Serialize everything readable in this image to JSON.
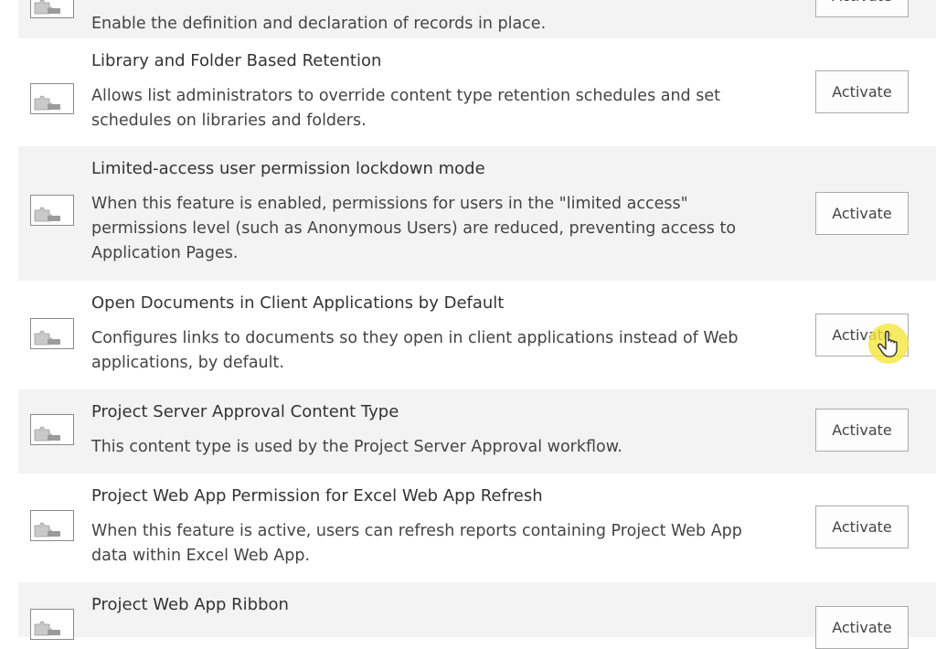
{
  "features": [
    {
      "title": "",
      "description": "Enable the definition and declaration of records in place.",
      "button_label": "Activate",
      "icon": "feature-puzzle-icon"
    },
    {
      "title": "Library and Folder Based Retention",
      "description": "Allows list administrators to override content type retention schedules and set schedules on libraries and folders.",
      "button_label": "Activate",
      "icon": "feature-puzzle-icon"
    },
    {
      "title": "Limited-access user permission lockdown mode",
      "description": "When this feature is enabled, permissions for users in the \"limited access\" permissions level (such as Anonymous Users) are reduced, preventing access to Application Pages.",
      "button_label": "Activate",
      "icon": "feature-puzzle-icon"
    },
    {
      "title": "Open Documents in Client Applications by Default",
      "description": "Configures links to documents so they open in client applications instead of Web applications, by default.",
      "button_label": "Activate",
      "icon": "feature-puzzle-icon"
    },
    {
      "title": "Project Server Approval Content Type",
      "description": "This content type is used by the Project Server Approval workflow.",
      "button_label": "Activate",
      "icon": "feature-puzzle-icon"
    },
    {
      "title": "Project Web App Permission for Excel Web App Refresh",
      "description": "When this feature is active, users can refresh reports containing Project Web App data within Excel Web App.",
      "button_label": "Activate",
      "icon": "feature-puzzle-icon"
    },
    {
      "title": "Project Web App Ribbon",
      "description": "",
      "button_label": "Activate",
      "icon": "feature-puzzle-icon"
    }
  ],
  "colors": {
    "row_shaded": "#f3f3f3",
    "row_plain": "#ffffff",
    "cursor_highlight": "#f5e63c"
  },
  "cursor": {
    "icon": "hand-pointer-icon"
  }
}
